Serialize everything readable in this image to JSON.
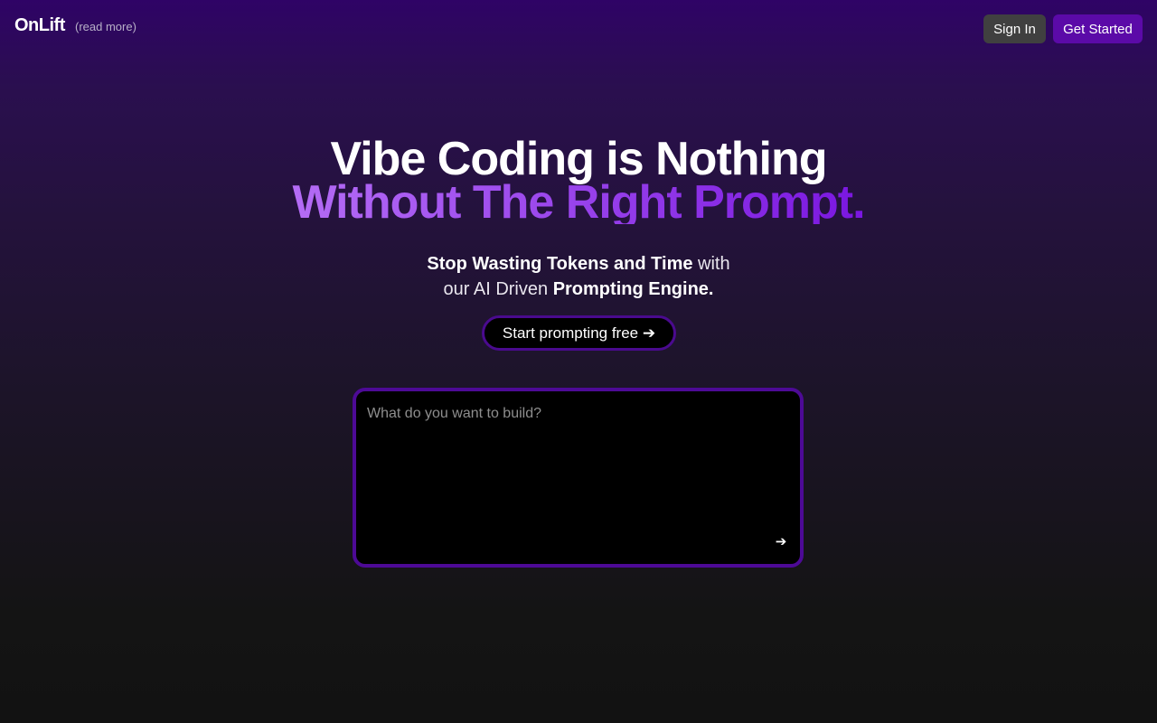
{
  "header": {
    "logo": "OnLift",
    "read_more": "(read more)",
    "sign_in": "Sign In",
    "get_started": "Get Started"
  },
  "hero": {
    "title_line1": "Vibe Coding is Nothing",
    "title_line2": "Without The Right Prompt.",
    "subtitle_part1_bold": "Stop Wasting Tokens and Time",
    "subtitle_part2": " with",
    "subtitle_part3": "our AI Driven ",
    "subtitle_part4_bold": "Prompting Engine.",
    "cta_label": "Start prompting free ➔"
  },
  "prompt": {
    "placeholder": "What do you want to build?",
    "value": "",
    "send_icon": "arrow-right-icon",
    "send_glyph": "➔"
  },
  "colors": {
    "accent": "#5b0aa8",
    "border_accent": "#4d0a96",
    "gradient_start": "#b46cf5",
    "gradient_end": "#7a16e0",
    "background_top": "#2f0366",
    "background_bottom": "#121212"
  }
}
